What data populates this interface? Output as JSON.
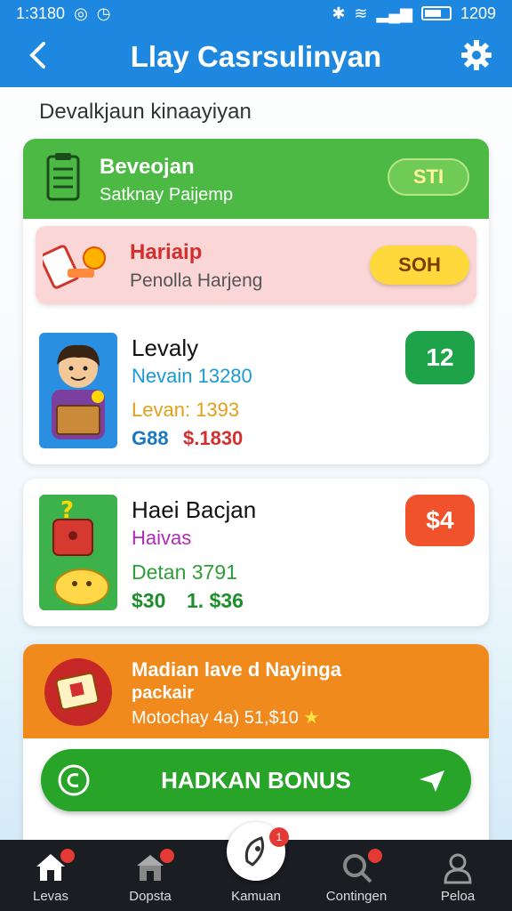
{
  "status": {
    "time": "1:3180",
    "right_text": "1209"
  },
  "header": {
    "title": "Llay Casrsulinyan"
  },
  "section": {
    "label": "Devalkjaun kinaayiyan"
  },
  "top_card": {
    "title": "Beveojan",
    "subtitle": "Satknay Paijemp",
    "button": "STI"
  },
  "alert_row": {
    "title": "Hariaip",
    "subtitle": "Penolla Harjeng",
    "button": "SOH"
  },
  "offers": [
    {
      "title": "Levaly",
      "line1": "Nevain 13280",
      "line2": "Levan: 1393",
      "price_a": "G88",
      "price_b": "$.1830",
      "badge": "12",
      "badge_color": "#1fa34a"
    },
    {
      "title": "Haei Bacjan",
      "line1": "Haivas",
      "line2": "Detan 3791",
      "price_a": "$30",
      "price_b": "1. $36",
      "badge": "$4",
      "badge_color": "#f0532b"
    }
  ],
  "promo": {
    "title": "Madian lave d Nayinga",
    "subtitle": "packair",
    "meta": "Motochay 4a) 51,$10"
  },
  "bonus_button": {
    "label": "HADKAN BONUS"
  },
  "nav": [
    {
      "label": "Levas",
      "badge": ""
    },
    {
      "label": "Dopsta",
      "badge": ""
    },
    {
      "label": "Kamuan",
      "badge": "1"
    },
    {
      "label": "Contingen",
      "badge": ""
    },
    {
      "label": "Peloa",
      "badge": ""
    }
  ],
  "colors": {
    "primary": "#1e88e0",
    "green": "#4cb944",
    "orange": "#f08a1c",
    "pink": "#fbd6d6",
    "yellow_pill": "#ffd93b"
  }
}
